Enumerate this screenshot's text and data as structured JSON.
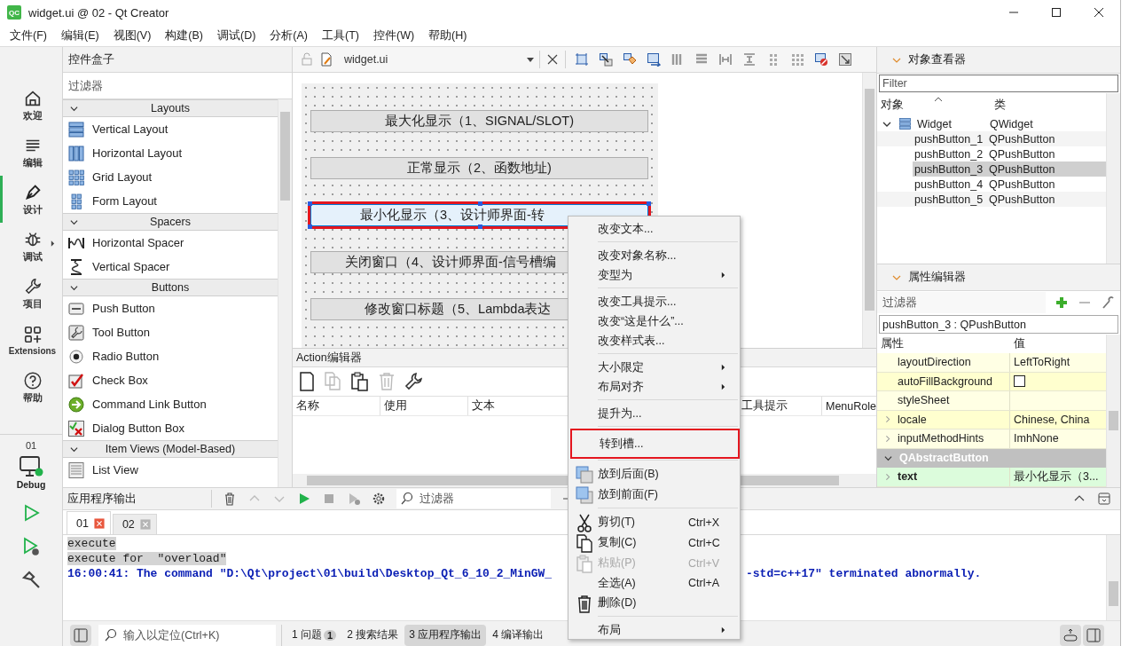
{
  "window": {
    "logo": "QC",
    "title": "widget.ui @ 02 - Qt Creator"
  },
  "menu_bar": [
    "文件(F)",
    "编辑(E)",
    "视图(V)",
    "构建(B)",
    "调试(D)",
    "分析(A)",
    "工具(T)",
    "控件(W)",
    "帮助(H)"
  ],
  "mode_bar": {
    "items": [
      {
        "label": "欢迎",
        "selected": false,
        "has_menu": false
      },
      {
        "label": "编辑",
        "selected": false,
        "has_menu": false
      },
      {
        "label": "设计",
        "selected": true,
        "has_menu": false
      },
      {
        "label": "调试",
        "selected": false,
        "has_menu": true
      },
      {
        "label": "项目",
        "selected": false,
        "has_menu": false
      },
      {
        "label": "Extensions",
        "selected": false,
        "has_menu": false
      },
      {
        "label": "帮助",
        "selected": false,
        "has_menu": false
      }
    ],
    "kit": {
      "project": "01",
      "build": "Debug"
    }
  },
  "widget_box": {
    "title": "控件盒子",
    "filter_placeholder": "过滤器",
    "categories": [
      {
        "name": "Layouts",
        "expanded": true,
        "items": [
          "Vertical Layout",
          "Horizontal Layout",
          "Grid Layout",
          "Form Layout"
        ]
      },
      {
        "name": "Spacers",
        "expanded": true,
        "items": [
          "Horizontal Spacer",
          "Vertical Spacer"
        ]
      },
      {
        "name": "Buttons",
        "expanded": true,
        "items": [
          "Push Button",
          "Tool Button",
          "Radio Button",
          "Check Box",
          "Command Link Button",
          "Dialog Button Box"
        ]
      },
      {
        "name": "Item Views (Model-Based)",
        "expanded": true,
        "items": [
          "List View"
        ]
      }
    ]
  },
  "editor": {
    "file": "widget.ui",
    "form_buttons": [
      {
        "text": "最大化显示（1、SIGNAL/SLOT)",
        "selected": false,
        "annotated": false
      },
      {
        "text": "正常显示（2、函数地址)",
        "selected": false,
        "annotated": false
      },
      {
        "text": "最小化显示（3、设计师界面-转",
        "selected": true,
        "annotated": true
      },
      {
        "text": "关闭窗口（4、设计师界面-信号槽编",
        "selected": false,
        "annotated": false
      },
      {
        "text": "修改窗口标题（5、Lambda表达",
        "selected": false,
        "annotated": false
      }
    ]
  },
  "action_editor": {
    "title": "Action编辑器",
    "columns": [
      "名称",
      "使用",
      "文本",
      "工具提示",
      "MenuRole"
    ]
  },
  "object_inspector": {
    "title": "对象查看器",
    "filter_placeholder": "Filter",
    "columns": [
      "对象",
      "类"
    ],
    "tree": [
      {
        "name": "Widget",
        "class": "QWidget",
        "expanded": true,
        "selected": false,
        "children": [
          {
            "name": "pushButton_1",
            "class": "QPushButton",
            "selected": false
          },
          {
            "name": "pushButton_2",
            "class": "QPushButton",
            "selected": false
          },
          {
            "name": "pushButton_3",
            "class": "QPushButton",
            "selected": true
          },
          {
            "name": "pushButton_4",
            "class": "QPushButton",
            "selected": false
          },
          {
            "name": "pushButton_5",
            "class": "QPushButton",
            "selected": false
          }
        ]
      }
    ]
  },
  "property_editor": {
    "title": "属性编辑器",
    "filter_placeholder": "过滤器",
    "object": "pushButton_3 : QPushButton",
    "columns": [
      "属性",
      "值"
    ],
    "rows": [
      {
        "kind": "property",
        "name": "layoutDirection",
        "value": "LeftToRight",
        "expandable": false,
        "modified": false,
        "color": "#ffffe4"
      },
      {
        "kind": "checkbox",
        "name": "autoFillBackground",
        "checked": false,
        "expandable": false,
        "modified": false,
        "color": "#ffffcf"
      },
      {
        "kind": "property",
        "name": "styleSheet",
        "expandable": false,
        "modified": false,
        "color": "#ffffe4"
      },
      {
        "kind": "property",
        "name": "locale",
        "value": "Chinese, China",
        "expandable": true,
        "modified": false,
        "color": "#ffffcf"
      },
      {
        "kind": "property",
        "name": "inputMethodHints",
        "value": "ImhNone",
        "expandable": true,
        "modified": false,
        "color": "#ffffe4"
      },
      {
        "kind": "section",
        "name": "QAbstractButton",
        "expanded": true
      },
      {
        "kind": "property",
        "name": "text",
        "value": "最小化显示（3...",
        "expandable": true,
        "modified": true,
        "color": "#dcfcdc"
      }
    ]
  },
  "output": {
    "title": "应用程序输出",
    "filter_placeholder": "过滤器",
    "tabs": [
      {
        "label": "01",
        "selected": true,
        "color": "#e8573d"
      },
      {
        "label": "02",
        "selected": false,
        "color": "#b4b4b4"
      }
    ],
    "lines": [
      {
        "kind": "stdout",
        "text": "execute",
        "highlighted": true
      },
      {
        "kind": "stdout",
        "text": "execute for  \"overload\"",
        "highlighted": true
      },
      {
        "kind": "status",
        "text": "16:00:41: The command \"D:\\Qt\\project\\01\\build\\Desktop_Qt_6_10_2_MinGW_",
        "text_after": "-std=c++17\" terminated abnormally.",
        "highlighted": false
      }
    ]
  },
  "status_bar": {
    "locator_placeholder": "输入以定位(Ctrl+K)",
    "panes": [
      {
        "number": "1",
        "label": "问题",
        "badge": "1",
        "selected": false
      },
      {
        "number": "2",
        "label": "搜索结果",
        "selected": false
      },
      {
        "number": "3",
        "label": "应用程序输出",
        "selected": true
      },
      {
        "number": "4",
        "label": "编译输出",
        "selected": false
      }
    ]
  },
  "context_menu": {
    "items": [
      {
        "kind": "item",
        "label": "改变文本...",
        "disabled": false,
        "annotated": false
      },
      {
        "kind": "separator"
      },
      {
        "kind": "item",
        "label": "改变对象名称...",
        "disabled": false,
        "annotated": false
      },
      {
        "kind": "submenu",
        "label": "变型为",
        "disabled": false,
        "annotated": false
      },
      {
        "kind": "separator"
      },
      {
        "kind": "item",
        "label": "改变工具提示...",
        "disabled": false,
        "annotated": false
      },
      {
        "kind": "item",
        "label": "改变“这是什么”...",
        "disabled": false,
        "annotated": false
      },
      {
        "kind": "item",
        "label": "改变样式表...",
        "disabled": false,
        "annotated": false
      },
      {
        "kind": "separator"
      },
      {
        "kind": "submenu",
        "label": "大小限定",
        "disabled": false,
        "annotated": false
      },
      {
        "kind": "submenu",
        "label": "布局对齐",
        "disabled": false,
        "annotated": false
      },
      {
        "kind": "separator"
      },
      {
        "kind": "item",
        "label": "提升为...",
        "disabled": false,
        "annotated": false
      },
      {
        "kind": "separator"
      },
      {
        "kind": "item",
        "label": "转到槽...",
        "disabled": false,
        "annotated": true
      },
      {
        "kind": "separator"
      },
      {
        "kind": "item",
        "label": "放到后面(B)",
        "disabled": false,
        "annotated": false
      },
      {
        "kind": "item",
        "label": "放到前面(F)",
        "disabled": false,
        "annotated": false
      },
      {
        "kind": "separator"
      },
      {
        "kind": "item",
        "label": "剪切(T)",
        "shortcut": "Ctrl+X",
        "disabled": false,
        "annotated": false
      },
      {
        "kind": "item",
        "label": "复制(C)",
        "shortcut": "Ctrl+C",
        "disabled": false,
        "annotated": false
      },
      {
        "kind": "item",
        "label": "粘贴(P)",
        "shortcut": "Ctrl+V",
        "disabled": true,
        "annotated": false
      },
      {
        "kind": "item",
        "label": "全选(A)",
        "shortcut": "Ctrl+A",
        "disabled": false,
        "annotated": false
      },
      {
        "kind": "item",
        "label": "删除(D)",
        "disabled": false,
        "annotated": false
      },
      {
        "kind": "separator"
      },
      {
        "kind": "submenu",
        "label": "布局",
        "disabled": false,
        "annotated": false
      }
    ]
  }
}
